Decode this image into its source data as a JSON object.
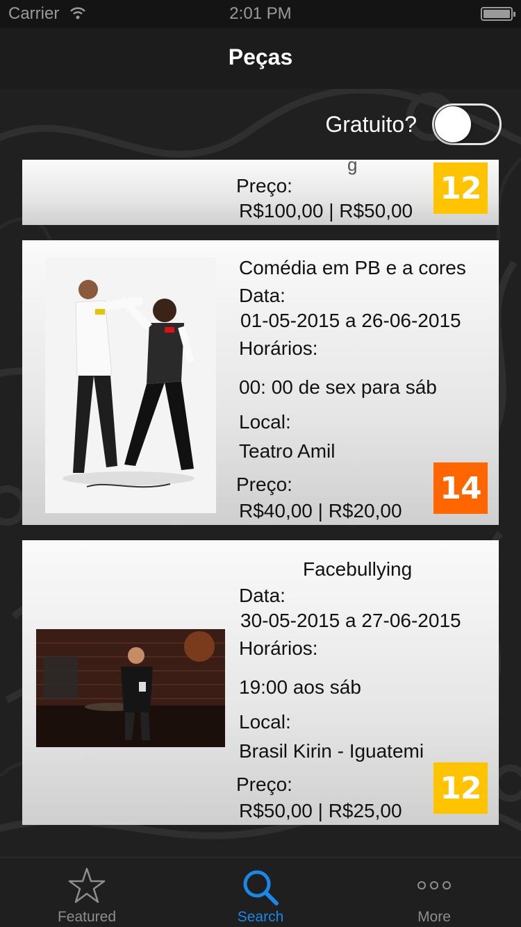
{
  "status_bar": {
    "carrier": "Carrier",
    "time": "2:01 PM"
  },
  "nav": {
    "title": "Peças"
  },
  "filter": {
    "label": "Gratuito?",
    "toggle_on": false
  },
  "items": [
    {
      "price_label": "Preço:",
      "price": "R$100,00 | R$50,00",
      "rating": "12",
      "rating_color": "#FFC300"
    },
    {
      "title": "Comédia em PB e a cores",
      "date_label": "Data:",
      "date": "01-05-2015 a 26-06-2015",
      "hours_label": "Horários:",
      "hours": "00: 00 de sex para sáb",
      "local_label": "Local:",
      "local": "Teatro Amil",
      "price_label": "Preço:",
      "price": "R$40,00 | R$20,00",
      "rating": "14",
      "rating_color": "#FF6600"
    },
    {
      "title": "Facebullying",
      "date_label": "Data:",
      "date": "30-05-2015 a 27-06-2015",
      "hours_label": "Horários:",
      "hours": "19:00 aos sáb",
      "local_label": "Local:",
      "local": "Brasil Kirin - Iguatemi",
      "price_label": "Preço:",
      "price": "R$50,00 | R$25,00",
      "rating": "12",
      "rating_color": "#FFC300"
    }
  ],
  "tabbar": {
    "tabs": [
      {
        "label": "Featured",
        "icon": "star-icon",
        "active": false
      },
      {
        "label": "Search",
        "icon": "search-icon",
        "active": true
      },
      {
        "label": "More",
        "icon": "more-icon",
        "active": false
      }
    ],
    "active_color": "#1A88E8"
  }
}
